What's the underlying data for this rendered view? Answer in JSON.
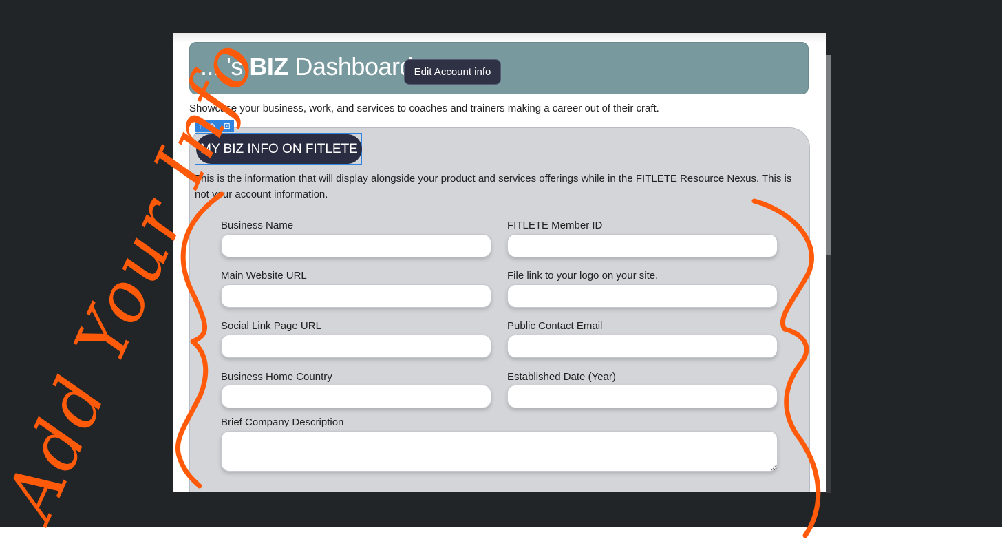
{
  "header": {
    "title_prefix": "... 's ",
    "title_bold": "BIZ",
    "title_suffix": " Dashboard",
    "edit_button_label": "Edit Account info"
  },
  "tagline": "Showcase your business, work, and services to coaches and trainers making a career out of their craft.",
  "editor_toolbar": {
    "move_icon": "arrow-up-icon",
    "edit_icon": "pencil-icon",
    "expand_icon": "expand-icon"
  },
  "section": {
    "title": "MY BIZ INFO ON FITLETE",
    "description": "This is the information that will display alongside your product and services offerings while in the FITLETE Resource Nexus. This is not your account information."
  },
  "form": {
    "business_name": {
      "label": "Business Name",
      "value": ""
    },
    "member_id": {
      "label": "FITLETE Member ID",
      "value": ""
    },
    "website_url": {
      "label": "Main Website URL",
      "value": ""
    },
    "logo_link": {
      "label": "File link to your logo on your site.",
      "value": ""
    },
    "social_url": {
      "label": "Social Link Page URL",
      "value": ""
    },
    "contact_email": {
      "label": "Public Contact Email",
      "value": ""
    },
    "home_country": {
      "label": "Business Home Country",
      "value": ""
    },
    "established_year": {
      "label": "Established Date (Year)",
      "value": ""
    },
    "description": {
      "label": "Brief Company Description",
      "value": ""
    }
  },
  "annotation": {
    "text": "Add Your Info",
    "color": "#ff5a0a"
  },
  "colors": {
    "header_bg": "#78999e",
    "pill_bg": "#2a2d42",
    "card_bg": "#d4d5d9",
    "selection": "#2f84e0"
  }
}
